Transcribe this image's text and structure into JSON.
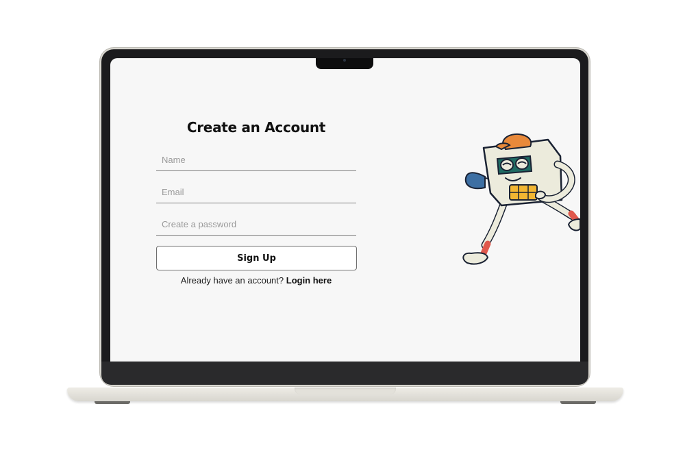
{
  "form": {
    "title": "Create an Account",
    "name_placeholder": "Name",
    "email_placeholder": "Email",
    "password_placeholder": "Create a password",
    "submit_label": "Sign Up",
    "login_prompt": "Already have an account?",
    "login_link": "Login here"
  },
  "colors": {
    "screen_background": "#f7f7f7",
    "text_primary": "#111111",
    "mascot_hat": "#e8893a",
    "mascot_chip": "#f2b632",
    "mascot_mask": "#1f6b63"
  },
  "icons": {
    "illustration": "walking-card-mascot-icon"
  }
}
